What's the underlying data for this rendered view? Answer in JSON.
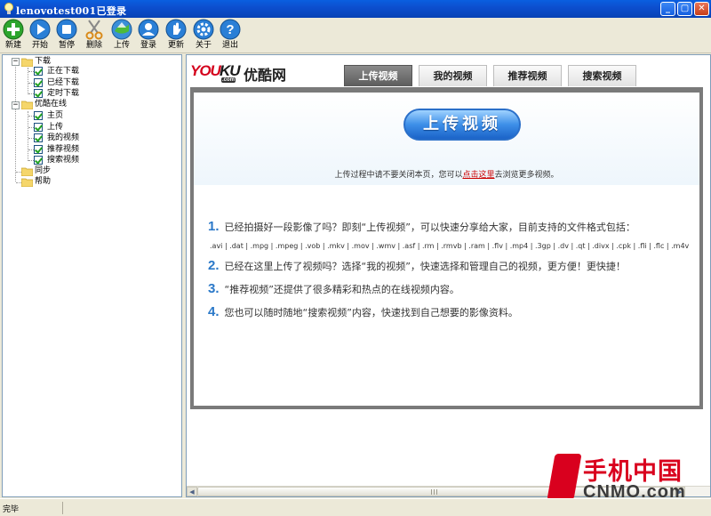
{
  "window": {
    "title": "lenovotest001已登录"
  },
  "toolbar": {
    "buttons": [
      {
        "label": "新建",
        "icon": "new-icon"
      },
      {
        "label": "开始",
        "icon": "play-icon"
      },
      {
        "label": "暂停",
        "icon": "pause-icon"
      },
      {
        "label": "删除",
        "icon": "scissors-icon"
      },
      {
        "label": "上传",
        "icon": "upload-icon"
      },
      {
        "label": "登录",
        "icon": "user-icon"
      },
      {
        "label": "更新",
        "icon": "hand-icon"
      },
      {
        "label": "关于",
        "icon": "gear-icon"
      },
      {
        "label": "退出",
        "icon": "help-icon"
      }
    ]
  },
  "tree": {
    "groups": [
      {
        "label": "下载",
        "expanded": true,
        "children": [
          "正在下载",
          "已经下载",
          "定时下载"
        ]
      },
      {
        "label": "优酷在线",
        "expanded": true,
        "children": [
          "主页",
          "上传",
          "我的视频",
          "推荐视频",
          "搜索视频"
        ]
      },
      {
        "label": "同步",
        "expanded": false,
        "children": []
      },
      {
        "label": "帮助",
        "expanded": false,
        "children": []
      }
    ]
  },
  "browser": {
    "logo": {
      "you": "YOU",
      "ku": "KU",
      "com": ".com",
      "cn": "优酷网"
    },
    "tabs": [
      {
        "label": "上传视频",
        "active": true
      },
      {
        "label": "我的视频",
        "active": false
      },
      {
        "label": "推荐视频",
        "active": false
      },
      {
        "label": "搜索视频",
        "active": false
      }
    ],
    "upload_button": "上传视频",
    "notice": {
      "before": "上传过程中请不要关闭本页，您可以",
      "link": "点击这里",
      "after": "去浏览更多视频。"
    },
    "steps": [
      {
        "num": "1.",
        "text": "已经拍摄好一段影像了吗？即刻“上传视频”，可以快速分享给大家，目前支持的文件格式包括："
      },
      {
        "num": "2.",
        "text": "已经在这里上传了视频吗？选择“我的视频”，快速选择和管理自己的视频，更方便！更快捷！"
      },
      {
        "num": "3.",
        "text": "“推荐视频”还提供了很多精彩和热点的在线视频内容。"
      },
      {
        "num": "4.",
        "text": "您也可以随时随地“搜索视频”内容，快速找到自己想要的影像资料。"
      }
    ],
    "formats": ".avi | .dat | .mpg | .mpeg | .vob | .mkv | .mov | .wmv | .asf | .rm | .rmvb | .ram | .flv | .mp4 | .3gp | .dv | .qt | .divx | .cpk | .fli | .flc | .m4v"
  },
  "watermark": {
    "cn": "手机中国",
    "en": "CNMO.com"
  },
  "status": {
    "text": "完毕"
  },
  "colors": {
    "titlebar": "#0c4fcf",
    "accent": "#2a78c8",
    "link": "#cc0000",
    "brand_red": "#d4001c"
  }
}
